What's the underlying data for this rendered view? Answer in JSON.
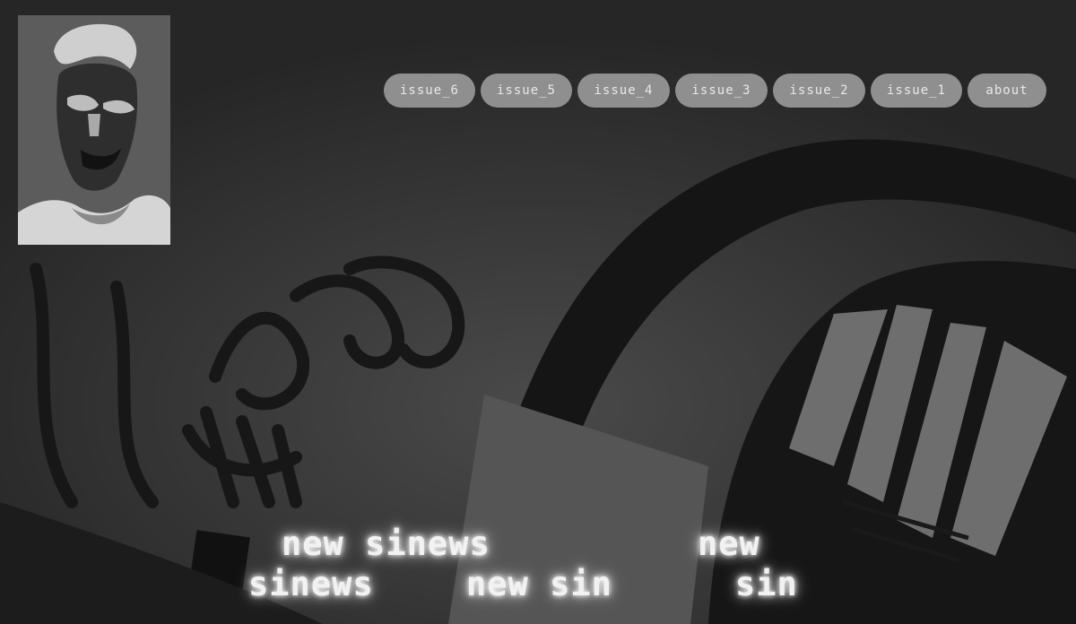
{
  "nav": {
    "items": [
      "issue_6",
      "issue_5",
      "issue_4",
      "issue_3",
      "issue_2",
      "issue_1",
      "about"
    ]
  },
  "title": {
    "line1_left": "new sinews",
    "line1_right": "new",
    "line2_left": "sinews",
    "line2_mid": "new sin",
    "line2_right": "sin"
  },
  "icons": {
    "portrait": "portrait-image",
    "background": "graffiti-wall-background"
  },
  "colors": {
    "nav_button": "#8f8f8f",
    "nav_text": "#e8e8e8",
    "title_glow": "#ffffff"
  }
}
